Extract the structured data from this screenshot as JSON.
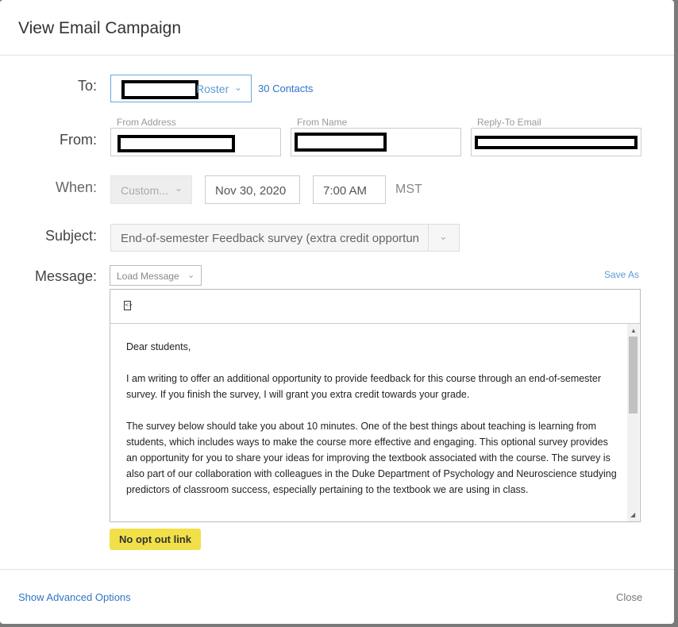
{
  "dialog": {
    "title": "View Email Campaign",
    "close_label": "Close",
    "advanced_label": "Show Advanced Options"
  },
  "to": {
    "label": "To:",
    "selected": "Roster",
    "contacts_link": "30 Contacts"
  },
  "from": {
    "label": "From:",
    "address_label": "From Address",
    "name_label": "From Name",
    "reply_label": "Reply-To Email"
  },
  "when": {
    "label": "When:",
    "mode": "Custom...",
    "date": "Nov 30, 2020",
    "time": "7:00 AM",
    "timezone": "MST"
  },
  "subject": {
    "label": "Subject:",
    "value": "End-of-semester Feedback survey (extra credit opportuni"
  },
  "message": {
    "label": "Message:",
    "load_label": "Load Message",
    "save_as_label": "Save As",
    "paragraphs": [
      "Dear students,",
      "I am writing to offer an additional opportunity to provide feedback for this course through an end-of-semester survey. If you finish the survey, I will grant you extra credit towards your grade.",
      "The survey below should take you about 10 minutes. One of the best things about teaching is learning from students, which includes ways to make the course more effective and engaging. This optional survey provides an opportunity for you to share your ideas for improving the textbook associated with the course. The survey is also part of our collaboration with colleagues in the Duke Department of Psychology and Neuroscience studying predictors of classroom success, especially pertaining to the textbook we are using in class."
    ],
    "opt_out_badge": "No opt out link"
  },
  "icons": {
    "chevron": "chevron-down-icon",
    "source": "source-code-icon"
  }
}
